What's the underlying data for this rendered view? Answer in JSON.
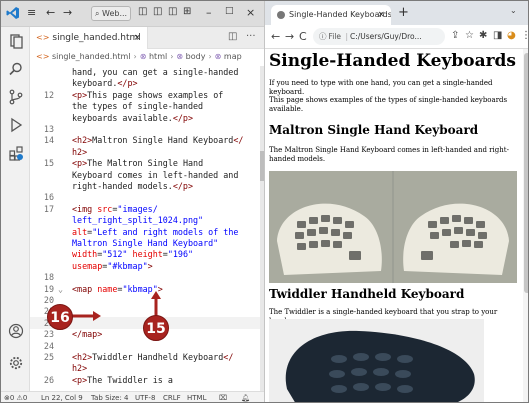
{
  "vscode": {
    "search_text": "Web...",
    "tab": {
      "label": "single_handed.html",
      "close": "×"
    },
    "breadcrumb": [
      "single_handed.html",
      "html",
      "body",
      "map"
    ],
    "lines": [
      {
        "num": "",
        "fold": "",
        "parts": [
          [
            "txt",
            "hand, you can get a single-handed"
          ]
        ]
      },
      {
        "num": "",
        "fold": "",
        "parts": [
          [
            "txt",
            "keyboard."
          ],
          [
            "tag",
            "</p>"
          ]
        ]
      },
      {
        "num": "12",
        "fold": "",
        "parts": [
          [
            "tag",
            "<p>"
          ],
          [
            "txt",
            "This page shows examples of"
          ]
        ]
      },
      {
        "num": "",
        "fold": "",
        "parts": [
          [
            "txt",
            "the types of single-handed"
          ]
        ]
      },
      {
        "num": "",
        "fold": "",
        "parts": [
          [
            "txt",
            "keyboards available."
          ],
          [
            "tag",
            "</p>"
          ]
        ]
      },
      {
        "num": "13",
        "fold": "",
        "parts": []
      },
      {
        "num": "14",
        "fold": "",
        "parts": [
          [
            "tag",
            "<h2>"
          ],
          [
            "txt",
            "Maltron Single Hand Keyboard"
          ],
          [
            "tag",
            "</"
          ]
        ]
      },
      {
        "num": "",
        "fold": "",
        "parts": [
          [
            "tag",
            "h2>"
          ]
        ]
      },
      {
        "num": "15",
        "fold": "",
        "parts": [
          [
            "tag",
            "<p>"
          ],
          [
            "txt",
            "The Maltron Single Hand"
          ]
        ]
      },
      {
        "num": "",
        "fold": "",
        "parts": [
          [
            "txt",
            "Keyboard comes in left-handed and"
          ]
        ]
      },
      {
        "num": "",
        "fold": "",
        "parts": [
          [
            "txt",
            "right-handed models."
          ],
          [
            "tag",
            "</p>"
          ]
        ]
      },
      {
        "num": "16",
        "fold": "",
        "parts": []
      },
      {
        "num": "17",
        "fold": "",
        "parts": [
          [
            "tag",
            "<img "
          ],
          [
            "attr",
            "src"
          ],
          [
            "txt",
            "="
          ],
          [
            "str",
            "\"images/"
          ]
        ]
      },
      {
        "num": "",
        "fold": "",
        "parts": [
          [
            "str",
            "left_right_split_1024.png\""
          ]
        ]
      },
      {
        "num": "",
        "fold": "",
        "parts": [
          [
            "attr",
            "alt"
          ],
          [
            "txt",
            "="
          ],
          [
            "str",
            "\"Left and right models of the"
          ]
        ]
      },
      {
        "num": "",
        "fold": "",
        "parts": [
          [
            "str",
            "Maltron Single Hand Keyboard\""
          ]
        ]
      },
      {
        "num": "",
        "fold": "",
        "parts": [
          [
            "attr",
            "width"
          ],
          [
            "txt",
            "="
          ],
          [
            "str",
            "\"512\" "
          ],
          [
            "attr",
            "height"
          ],
          [
            "txt",
            "="
          ],
          [
            "str",
            "\"196\""
          ]
        ]
      },
      {
        "num": "",
        "fold": "",
        "parts": [
          [
            "attr",
            "usemap"
          ],
          [
            "txt",
            "="
          ],
          [
            "str",
            "\"#kbmap\""
          ],
          [
            "tag",
            ">"
          ]
        ]
      },
      {
        "num": "18",
        "fold": "",
        "parts": []
      },
      {
        "num": "19",
        "fold": "v",
        "parts": [
          [
            "tag",
            "<map "
          ],
          [
            "attr",
            "name"
          ],
          [
            "txt",
            "="
          ],
          [
            "str",
            "\"kbmap\""
          ],
          [
            "tag",
            ">"
          ]
        ]
      },
      {
        "num": "20",
        "fold": "",
        "parts": []
      },
      {
        "num": "21",
        "fold": "",
        "parts": []
      },
      {
        "num": "22",
        "fold": "",
        "parts": []
      },
      {
        "num": "23",
        "fold": "",
        "parts": [
          [
            "tag",
            "</map>"
          ]
        ]
      },
      {
        "num": "24",
        "fold": "",
        "parts": []
      },
      {
        "num": "25",
        "fold": "",
        "parts": [
          [
            "tag",
            "<h2>"
          ],
          [
            "txt",
            "Twiddler Handheld Keyboard"
          ],
          [
            "tag",
            "</"
          ]
        ]
      },
      {
        "num": "",
        "fold": "",
        "parts": [
          [
            "tag",
            "h2>"
          ]
        ]
      },
      {
        "num": "26",
        "fold": "",
        "parts": [
          [
            "tag",
            "<p>"
          ],
          [
            "txt",
            "The Twiddler is a"
          ]
        ]
      }
    ],
    "status": {
      "errors": "⊗0 ⚠0",
      "position": "Ln 22, Col 9",
      "tab_size": "Tab Size: 4",
      "encoding": "UTF-8",
      "eol": "CRLF",
      "language": "HTML"
    }
  },
  "callouts": {
    "first": "16",
    "second": "15"
  },
  "chrome": {
    "tab_title": "Single-Handed Keyboards",
    "tab_close": "×",
    "new_tab": "+",
    "omnibox_scheme": "File",
    "omnibox_url": "C:/Users/Guy/Dro...",
    "page": {
      "h1": "Single-Handed Keyboards",
      "intro": "If you need to type with one hand, you can get a single-handed keyboard.",
      "intro2": "This page shows examples of the types of single-handed keyboards available.",
      "h2_maltron": "Maltron Single Hand Keyboard",
      "maltron_text": "The Maltron Single Hand Keyboard comes in left-handed and right-handed models.",
      "h2_twiddler": "Twiddler Handheld Keyboard",
      "twiddler_text": "The Twiddler is a single-handed keyboard that you strap to your hand."
    }
  }
}
